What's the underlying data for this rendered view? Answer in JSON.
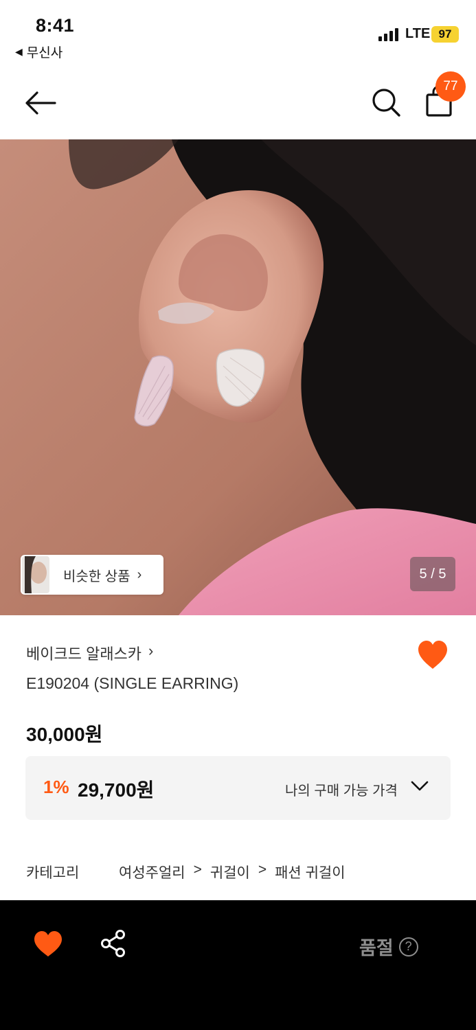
{
  "status_bar": {
    "time": "8:41",
    "back_app": "무신사",
    "network": "LTE",
    "battery": "97"
  },
  "header": {
    "cart_count": "77",
    "icons": [
      "back-arrow-icon",
      "search-icon",
      "shopping-bag-icon"
    ]
  },
  "gallery": {
    "similar_label": "비슷한 상품",
    "similar_chevron": "›",
    "page_indicator": "5 / 5"
  },
  "product": {
    "brand": "베이크드 알래스카",
    "brand_chevron": "›",
    "name": "E190204 (SINGLE EARRING)",
    "price": "30,000원",
    "liked": true
  },
  "member_price": {
    "discount": "1%",
    "price": "29,700원",
    "label": "나의 구매 가능 가격"
  },
  "category": {
    "label": "카테고리",
    "path": [
      "여성주얼리",
      "귀걸이",
      "패션 귀걸이"
    ],
    "separator": ">"
  },
  "bottom_bar": {
    "sold_out": "품절",
    "help": "?"
  },
  "colors": {
    "accent": "#ff5a14",
    "battery": "#f6d231",
    "bottom_bar": "#000000",
    "member_box": "#f4f4f4"
  }
}
